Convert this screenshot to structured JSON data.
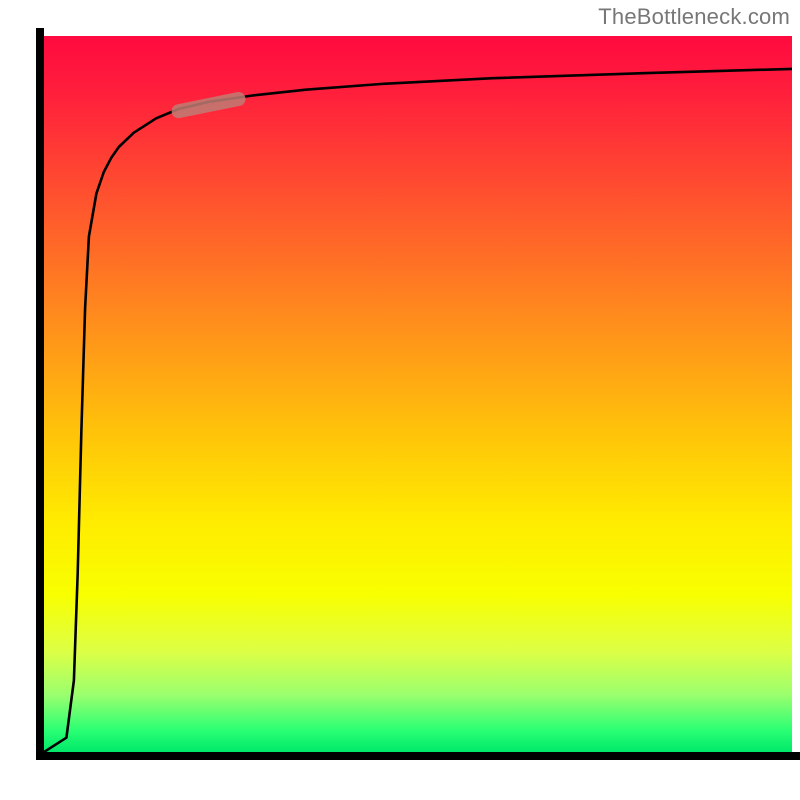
{
  "watermark": "TheBottleneck.com",
  "colors": {
    "curve_stroke": "#000000",
    "marker_stroke": "#bf7d74",
    "frame": "#000000"
  },
  "chart_data": {
    "type": "line",
    "title": "",
    "xlabel": "",
    "ylabel": "",
    "xlim": [
      0,
      100
    ],
    "ylim": [
      0,
      100
    ],
    "x": [
      0,
      3,
      4,
      4.5,
      5,
      5.5,
      6,
      7,
      8,
      9,
      10,
      12,
      15,
      18,
      22,
      28,
      35,
      45,
      60,
      80,
      100
    ],
    "values": [
      0,
      2,
      10,
      25,
      45,
      62,
      72,
      78,
      81,
      83,
      84.5,
      86.5,
      88.5,
      89.8,
      90.8,
      91.7,
      92.5,
      93.3,
      94.1,
      94.8,
      95.4
    ],
    "marker": {
      "x_range": [
        18,
        26
      ],
      "y_range": [
        89.5,
        91.2
      ]
    },
    "gradient_stops": [
      {
        "pct": 0,
        "color": "#ff0a3f"
      },
      {
        "pct": 25,
        "color": "#ff5a2c"
      },
      {
        "pct": 55,
        "color": "#ffc20a"
      },
      {
        "pct": 78,
        "color": "#f8ff00"
      },
      {
        "pct": 97,
        "color": "#2aff74"
      },
      {
        "pct": 100,
        "color": "#00e86a"
      }
    ]
  }
}
